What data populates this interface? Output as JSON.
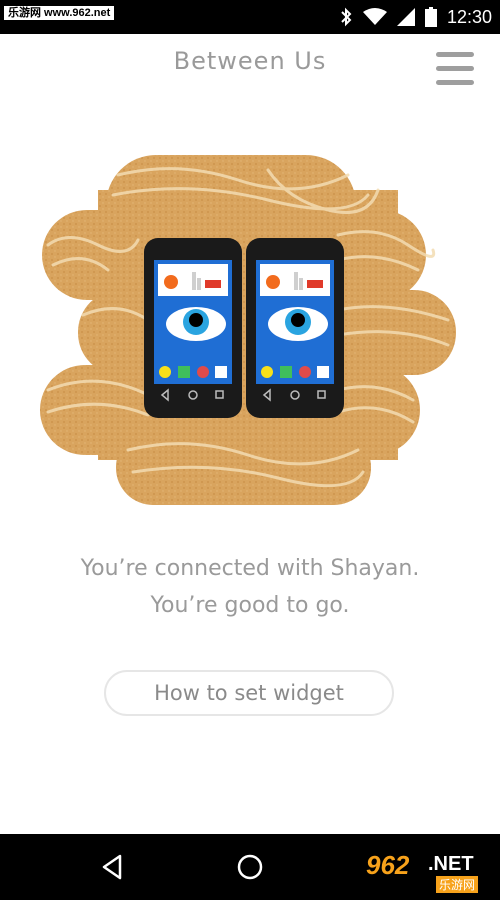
{
  "status_bar": {
    "watermark": "乐游网 www.962.net",
    "time": "12:30",
    "icons": [
      "bluetooth-icon",
      "wifi-icon",
      "cell-signal-icon",
      "battery-icon"
    ]
  },
  "app_bar": {
    "title": "Between Us",
    "menu_icon": "hamburger-menu-icon"
  },
  "illustration": {
    "description_icon": "two-phones-eye-icon",
    "colors": {
      "wood": "#d9a45e",
      "grain": "#f3dcb2",
      "phone": "#1a1a1a",
      "screen": "#1f6ed4",
      "eye_iris": "#2aa4e0"
    }
  },
  "message": {
    "line1": "You’re connected with Shayan.",
    "line2": "You’re good to go."
  },
  "widget_button": {
    "label": "How to set widget"
  },
  "nav_bar": {
    "icons": [
      "back-icon",
      "home-icon"
    ],
    "watermark_number": "962",
    "watermark_net": ".NET",
    "watermark_cn": "乐游网"
  }
}
